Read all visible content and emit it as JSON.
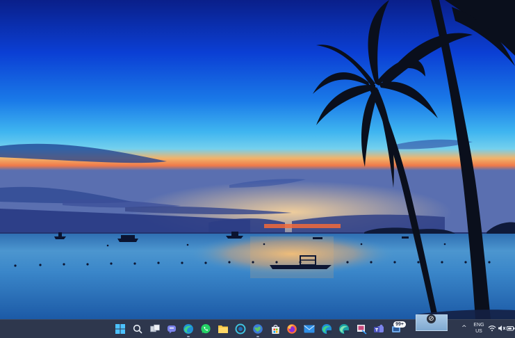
{
  "wallpaper": {
    "description_icon": "beach-sunset-palm-trees"
  },
  "taskbar": {
    "pinned": [
      {
        "name": "start-button",
        "icon": "windows-logo"
      },
      {
        "name": "search-button",
        "icon": "search-icon"
      },
      {
        "name": "task-view-button",
        "icon": "task-view-icon"
      },
      {
        "name": "chat-button",
        "icon": "teams-chat-icon"
      },
      {
        "name": "edge-button",
        "icon": "edge-icon"
      },
      {
        "name": "whatsapp-button",
        "icon": "whatsapp-icon"
      },
      {
        "name": "file-explorer-button",
        "icon": "folder-icon"
      },
      {
        "name": "cortana-button",
        "icon": "circle-app-icon"
      },
      {
        "name": "globe-browser-button",
        "icon": "globe-icon"
      },
      {
        "name": "store-button",
        "icon": "store-icon"
      },
      {
        "name": "firefox-button",
        "icon": "firefox-icon"
      },
      {
        "name": "mail-button",
        "icon": "mail-icon"
      },
      {
        "name": "edge-beta-button",
        "icon": "edge-beta-icon"
      },
      {
        "name": "edge-dev-button",
        "icon": "edge-dev-icon"
      },
      {
        "name": "snip-button",
        "icon": "snip-icon"
      },
      {
        "name": "teams-button",
        "icon": "teams-icon"
      },
      {
        "name": "app-with-badge-button",
        "icon": "app-icon"
      }
    ],
    "notification_badge": "99+",
    "tray": {
      "chevron": "^",
      "language_line1": "ENG",
      "language_line2": "US",
      "wifi_icon": "wifi-icon",
      "volume_icon": "volume-muted-icon",
      "battery_icon": "battery-icon"
    },
    "blocked_glyph": "⊘"
  }
}
